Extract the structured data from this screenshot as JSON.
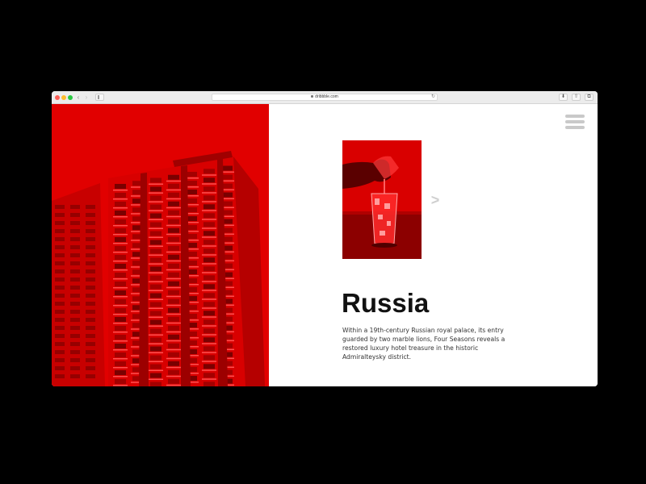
{
  "browser": {
    "url": "dribbble.com",
    "back_glyph": "‹",
    "forward_glyph": "›",
    "reload_glyph": "↻",
    "download_glyph": "⬇",
    "share_glyph": "⇧",
    "tabs_glyph": "⧉"
  },
  "icons": {
    "close": "close-traffic-light-icon",
    "minimize": "minimize-traffic-light-icon",
    "zoom": "zoom-traffic-light-icon",
    "menu": "hamburger-menu-icon",
    "next": "chevron-right-icon"
  },
  "page": {
    "next_glyph": ">",
    "title": "Russia",
    "description": "Within a 19th-century Russian royal palace, its entry guarded by two marble lions, Four Seasons reveals a restored luxury hotel treasure in the historic Admiralteysky district."
  },
  "colors": {
    "hero_tint": "#e10000",
    "background": "#ffffff",
    "frame": "#000000",
    "menu_bars": "#c9c9c9"
  }
}
